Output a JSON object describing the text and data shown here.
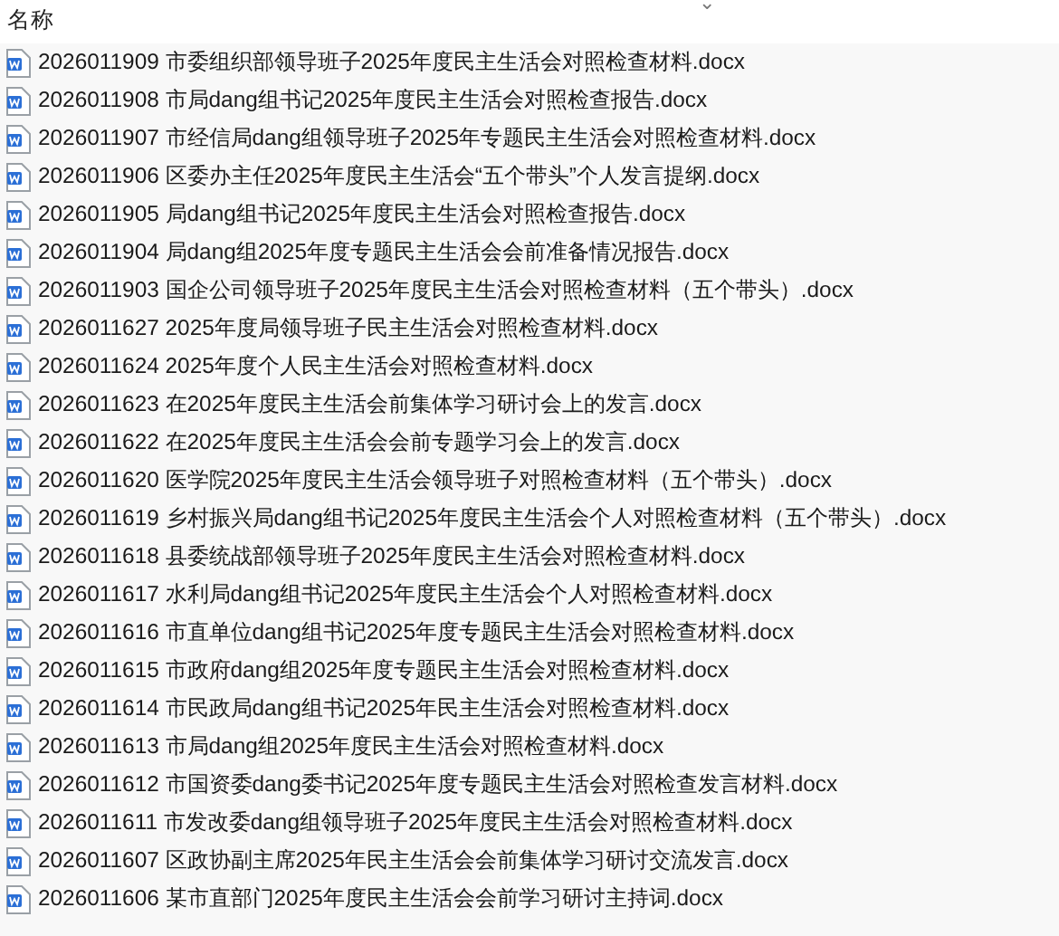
{
  "header": {
    "column": "名称",
    "sort_indicator": "⌄"
  },
  "files": [
    {
      "name": "2026011909 市委组织部领导班子2025年度民主生活会对照检查材料.docx",
      "kind": "word"
    },
    {
      "name": "2026011908 市局dang组书记2025年度民主生活会对照检查报告.docx",
      "kind": "word"
    },
    {
      "name": "2026011907 市经信局dang组领导班子2025年专题民主生活会对照检查材料.docx",
      "kind": "word"
    },
    {
      "name": "2026011906 区委办主任2025年度民主生活会“五个带头”个人发言提纲.docx",
      "kind": "word"
    },
    {
      "name": "2026011905 局dang组书记2025年度民主生活会对照检查报告.docx",
      "kind": "word"
    },
    {
      "name": "2026011904 局dang组2025年度专题民主生活会会前准备情况报告.docx",
      "kind": "word"
    },
    {
      "name": "2026011903 国企公司领导班子2025年度民主生活会对照检查材料（五个带头）.docx",
      "kind": "word"
    },
    {
      "name": "2026011627 2025年度局领导班子民主生活会对照检查材料.docx",
      "kind": "word"
    },
    {
      "name": "2026011624 2025年度个人民主生活会对照检查材料.docx",
      "kind": "word"
    },
    {
      "name": "2026011623 在2025年度民主生活会前集体学习研讨会上的发言.docx",
      "kind": "word"
    },
    {
      "name": "2026011622 在2025年度民主生活会会前专题学习会上的发言.docx",
      "kind": "word"
    },
    {
      "name": "2026011620 医学院2025年度民主生活会领导班子对照检查材料（五个带头）.docx",
      "kind": "word"
    },
    {
      "name": "2026011619 乡村振兴局dang组书记2025年度民主生活会个人对照检查材料（五个带头）.docx",
      "kind": "word"
    },
    {
      "name": "2026011618 县委统战部领导班子2025年度民主生活会对照检查材料.docx",
      "kind": "word"
    },
    {
      "name": "2026011617 水利局dang组书记2025年度民主生活会个人对照检查材料.docx",
      "kind": "word"
    },
    {
      "name": "2026011616 市直单位dang组书记2025年度专题民主生活会对照检查材料.docx",
      "kind": "word"
    },
    {
      "name": "2026011615 市政府dang组2025年度专题民主生活会对照检查材料.docx",
      "kind": "word"
    },
    {
      "name": "2026011614 市民政局dang组书记2025年民主生活会对照检查材料.docx",
      "kind": "word"
    },
    {
      "name": "2026011613 市局dang组2025年度民主生活会对照检查材料.docx",
      "kind": "word"
    },
    {
      "name": "2026011612 市国资委dang委书记2025年度专题民主生活会对照检查发言材料.docx",
      "kind": "word"
    },
    {
      "name": "2026011611 市发改委dang组领导班子2025年度民主生活会对照检查材料.docx",
      "kind": "word"
    },
    {
      "name": "2026011607 区政协副主席2025年民主生活会会前集体学习研讨交流发言.docx",
      "kind": "word"
    },
    {
      "name": "2026011606 某市直部门2025年度民主生活会会前学习研讨主持词.docx",
      "kind": "word"
    }
  ]
}
